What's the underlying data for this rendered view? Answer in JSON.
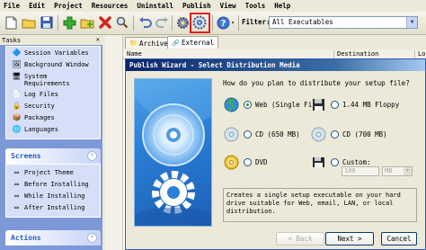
{
  "menu": [
    "File",
    "Edit",
    "Project",
    "Resources",
    "Uninstall",
    "Publish",
    "View",
    "Tools",
    "Help"
  ],
  "toolbar": {
    "filter_label": "Filter:",
    "filter_value": "All Executables"
  },
  "tasks": {
    "title": "Tasks",
    "group1": [
      "Session Variables",
      "Background Window",
      "System",
      "Requirements",
      "Log Files",
      "Security",
      "Packages",
      "Languages"
    ],
    "screens_header": "Screens",
    "screens": [
      "Project Theme",
      "Before Installing",
      "While Installing",
      "After Installing"
    ],
    "actions_header": "Actions"
  },
  "tabs": [
    "Archive",
    "External"
  ],
  "list_columns": [
    "Name",
    "Destination",
    "Lo"
  ],
  "dialog": {
    "title": "Publish Wizard - Select Distribution Media",
    "question": "How do you plan to distribute your setup file?",
    "options": [
      "Web (Single Fi",
      "1.44 MB Floppy",
      "CD (650 MB)",
      "CD (700 MB)",
      "DVD",
      "Custom:"
    ],
    "custom_value": "100",
    "custom_unit": "MB",
    "description": "Creates a single setup executable on your hard drive suitable for Web, email, LAN, or local distribution.",
    "btn_back": "< Back",
    "btn_next": "Next >",
    "btn_cancel": "Cancel"
  },
  "colors": {
    "accent": "#215DC6",
    "highlight": "#E41B1B",
    "tasks_bg": "#7C98D6"
  }
}
